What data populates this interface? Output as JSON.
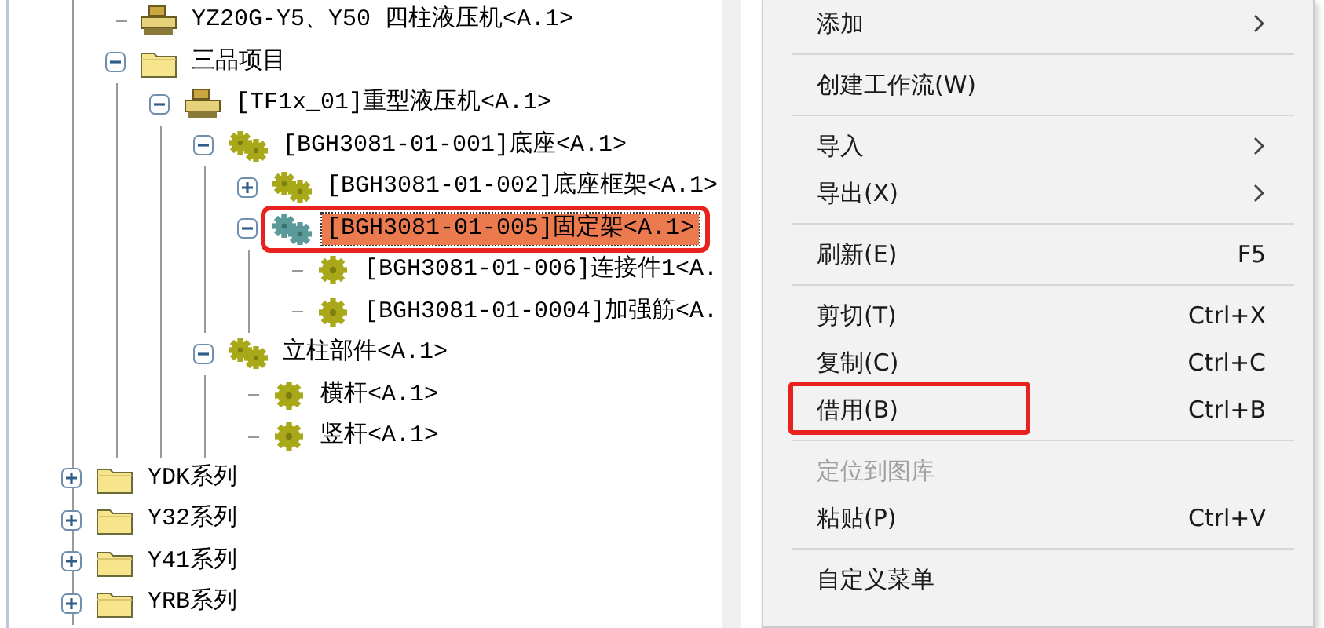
{
  "tree": {
    "continued_children": [
      {
        "label": "YZ20G-Y5、Y50 四柱液压机<A.1>",
        "kind": "assembly"
      },
      {
        "label": "三品项目",
        "kind": "folder",
        "expanded": true,
        "children": [
          {
            "label": "[TF1x_01]重型液压机<A.1>",
            "kind": "assembly",
            "expanded": true,
            "children": [
              {
                "label": "[BGH3081-01-001]底座<A.1>",
                "kind": "subassembly",
                "expanded": true,
                "children": [
                  {
                    "label": "[BGH3081-01-002]底座框架<A.1>",
                    "kind": "subassembly",
                    "expanded": false
                  },
                  {
                    "label": "[BGH3081-01-005]固定架<A.1>",
                    "kind": "subassembly",
                    "expanded": true,
                    "selected": true,
                    "annotated": true,
                    "children": [
                      {
                        "label": "[BGH3081-01-006]连接件1<A.",
                        "kind": "part"
                      },
                      {
                        "label": "[BGH3081-01-0004]加强筋<A.",
                        "kind": "part"
                      }
                    ]
                  }
                ]
              },
              {
                "label": "立柱部件<A.1>",
                "kind": "subassembly",
                "expanded": true,
                "children": [
                  {
                    "label": "横杆<A.1>",
                    "kind": "part"
                  },
                  {
                    "label": "竖杆<A.1>",
                    "kind": "part"
                  }
                ]
              }
            ]
          }
        ]
      }
    ],
    "nodes": [
      {
        "label": "YDK系列",
        "kind": "folder",
        "expanded": false
      },
      {
        "label": "Y32系列",
        "kind": "folder",
        "expanded": false
      },
      {
        "label": "Y41系列",
        "kind": "folder",
        "expanded": false
      },
      {
        "label": "YRB系列",
        "kind": "folder",
        "expanded": false
      }
    ]
  },
  "context_menu": {
    "items": [
      {
        "kind": "item",
        "label": "添加",
        "submenu": true
      },
      {
        "kind": "separator"
      },
      {
        "kind": "item",
        "label": "创建工作流(W)"
      },
      {
        "kind": "separator"
      },
      {
        "kind": "item",
        "label": "导入",
        "submenu": true
      },
      {
        "kind": "item",
        "label": "导出(X)",
        "submenu": true
      },
      {
        "kind": "separator"
      },
      {
        "kind": "item",
        "label": "刷新(E)",
        "shortcut": "F5"
      },
      {
        "kind": "separator"
      },
      {
        "kind": "item",
        "label": "剪切(T)",
        "shortcut": "Ctrl+X"
      },
      {
        "kind": "item",
        "label": "复制(C)",
        "shortcut": "Ctrl+C"
      },
      {
        "kind": "item",
        "label": "借用(B)",
        "shortcut": "Ctrl+B",
        "annotated": true
      },
      {
        "kind": "separator"
      },
      {
        "kind": "item",
        "label": "定位到图库",
        "disabled": true
      },
      {
        "kind": "item",
        "label": "粘贴(P)",
        "shortcut": "Ctrl+V"
      },
      {
        "kind": "separator"
      },
      {
        "kind": "item",
        "label": "自定义菜单"
      }
    ]
  }
}
